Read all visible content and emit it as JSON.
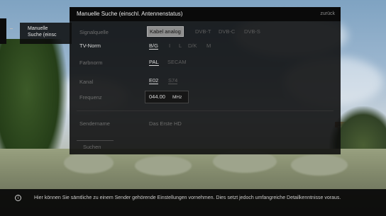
{
  "side": {
    "item_label_line1": "Manuelle",
    "item_label_line2": "Suche (einsc"
  },
  "dialog": {
    "title": "Manuelle Suche (einschl. Antennenstatus)",
    "back": "zurück",
    "rows": {
      "signal": {
        "label": "Signalquelle",
        "options": [
          "Kabel analog",
          "DVB-T",
          "DVB-C",
          "DVB-S"
        ],
        "selected": "Kabel analog"
      },
      "tvnorm": {
        "label": "TV-Norm",
        "options": [
          "B/G",
          "I",
          "L",
          "D/K",
          "M"
        ],
        "selected": "B/G"
      },
      "farbnorm": {
        "label": "Farbnorm",
        "options": [
          "PAL",
          "SECAM"
        ],
        "selected": "PAL"
      },
      "kanal": {
        "label": "Kanal",
        "options": [
          "E02",
          "S74"
        ],
        "selected": "E02"
      },
      "frequenz": {
        "label": "Frequenz",
        "value": "044.00",
        "unit": "MHz"
      },
      "sendername": {
        "label": "Sendername",
        "value": "Das Erste HD"
      }
    },
    "search_button": "Suchen"
  },
  "info": {
    "icon": "info-icon",
    "icon_glyph": "i",
    "text": "Hier können Sie sämtliche zu einem Sender gehörende Einstellungen vornehmen. Dies setzt jedoch umfangreiche Detailkenntnisse voraus."
  }
}
